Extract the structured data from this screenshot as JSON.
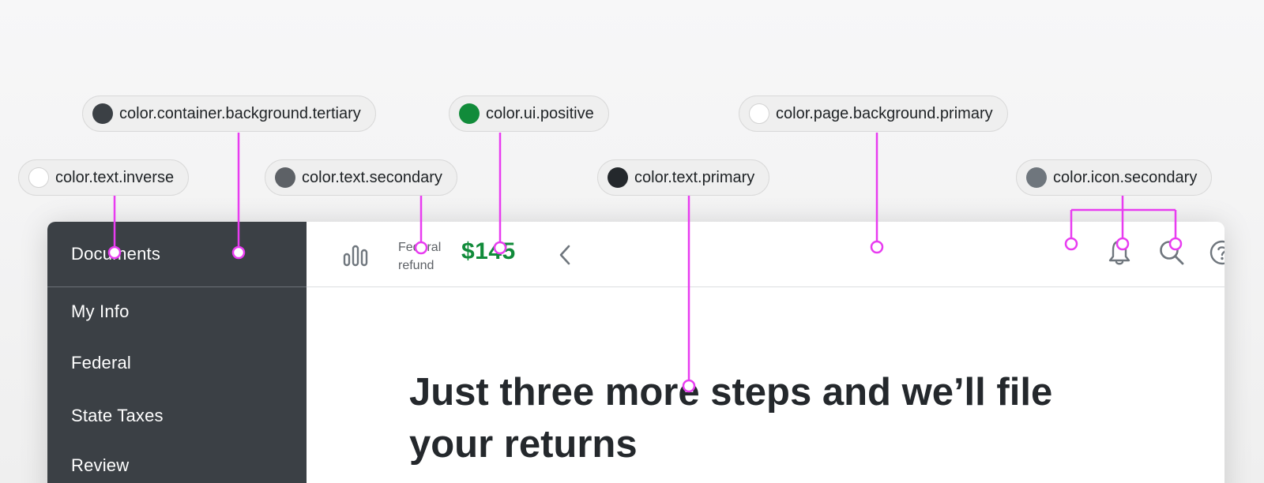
{
  "sidebar": {
    "items": [
      {
        "label": "Documents"
      },
      {
        "label": "My Info"
      },
      {
        "label": "Federal"
      },
      {
        "label": "State Taxes"
      },
      {
        "label": "Review"
      }
    ]
  },
  "topbar": {
    "refund_label": "Federal refund",
    "refund_amount": "$145",
    "icons": [
      "bar-chart-icon",
      "chevron-left-icon",
      "bell-icon",
      "search-icon",
      "help-icon"
    ]
  },
  "main": {
    "headline": "Just three more steps and we’ll file your returns"
  },
  "annotations": [
    {
      "token": "color.container.background.tertiary",
      "swatch": "#3b4045"
    },
    {
      "token": "color.ui.positive",
      "swatch": "#118b3a"
    },
    {
      "token": "color.page.background.primary",
      "swatch": "#ffffff"
    },
    {
      "token": "color.text.inverse",
      "swatch": "#ffffff"
    },
    {
      "token": "color.text.secondary",
      "swatch": "#5d6166"
    },
    {
      "token": "color.text.primary",
      "swatch": "#24282c"
    },
    {
      "token": "color.icon.secondary",
      "swatch": "#6f767d"
    }
  ],
  "colors": {
    "annotation_line": "#e83cf0",
    "sidebar_bg": "#3b4045",
    "positive": "#118b3a",
    "icon_secondary": "#6f767d"
  }
}
